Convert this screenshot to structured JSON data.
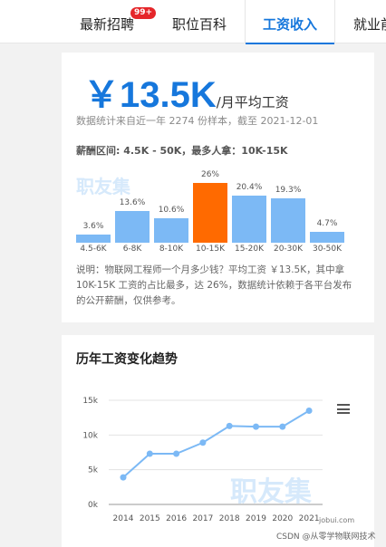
{
  "tabs": [
    {
      "label": "最新招聘"
    },
    {
      "label": "职位百科"
    },
    {
      "label": "工资收入",
      "active": true
    },
    {
      "label": "就业前"
    }
  ],
  "badge": "99+",
  "salary": {
    "value": "￥13.5K",
    "unit": "/月平均工资",
    "stat_note": "数据统计来自近一年 2274 份样本，截至 2021-12-01",
    "range_note": "薪酬区间: 4.5K - 50K，最多人拿：10K-15K",
    "description": "说明：物联网工程师一个月多少钱？平均工资 ￥13.5K，其中拿 10K-15K 工资的占比最多，达 26%，数据统计依赖于各平台发布的公开薪酬，仅供参考。"
  },
  "watermark": "职友集",
  "distribution": {
    "categories": [
      "4.5-6K",
      "6-8K",
      "8-10K",
      "10-15K",
      "15-20K",
      "20-30K",
      "30-50K"
    ],
    "values": [
      3.6,
      13.6,
      10.6,
      26,
      20.4,
      19.3,
      4.7
    ],
    "labels": [
      "3.6%",
      "13.6%",
      "10.6%",
      "26%",
      "20.4%",
      "19.3%",
      "4.7%"
    ],
    "highlight_index": 3,
    "colors": {
      "bar": "#7cb9f5",
      "highlight": "#ff6a00"
    }
  },
  "trend": {
    "title": "历年工资变化趋势",
    "menu_icon": "hamburger-menu-icon"
  },
  "chart_data": {
    "type": "line",
    "x": [
      "2014",
      "2015",
      "2016",
      "2017",
      "2018",
      "2019",
      "2020",
      "2021"
    ],
    "series": [
      {
        "values": [
          3900,
          7300,
          7300,
          8900,
          11300,
          11200,
          11200,
          13500
        ]
      }
    ],
    "ylim": [
      0,
      15000
    ],
    "yticks": [
      "0k",
      "5k",
      "10k",
      "15k"
    ],
    "grid": true,
    "color": "#7cb9f5"
  },
  "source_label": "jobui.com",
  "footer": "CSDN @从零学物联网技术"
}
